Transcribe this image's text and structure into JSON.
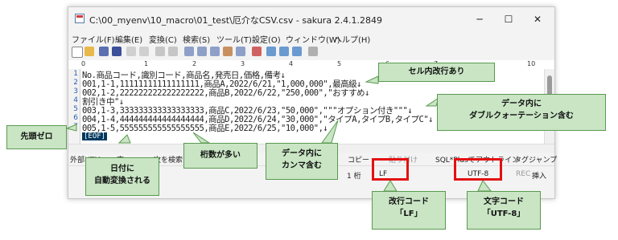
{
  "window": {
    "title": "C:\\00_myenv\\10_macro\\01_test\\厄介なCSV.csv - sakura 2.4.1.2849",
    "controls": {
      "minimize": "─",
      "maximize": "☐",
      "close": "✕"
    }
  },
  "menu": [
    "ファイル(F)",
    "編集(E)",
    "変換(C)",
    "検索(S)",
    "ツール(T)",
    "設定(O)",
    "ウィンドウ(W)",
    "ヘルプ(H)"
  ],
  "ruler": {
    "marks": [
      "0",
      "1",
      "2",
      "3",
      "4",
      "5",
      "6",
      "7",
      "10"
    ]
  },
  "editor": {
    "lines": [
      {
        "n": "1",
        "text": "No.商品コード,識別コード,商品名,発売日,価格,備考↓"
      },
      {
        "n": "2",
        "text": "001,1-1,11111111111111111,商品A,2022/6/21,\"1,000,000\",最高級↓"
      },
      {
        "n": "3",
        "text": "002,1-2,222222222222222222,商品B,2022/6/22,\"250,000\",\"おすすめ↓"
      },
      {
        "n": "4",
        "text": "割引き中\"↓"
      },
      {
        "n": "5",
        "text": "003,1-3,333333333333333333,商品C,2022/6/23,\"50,000\",\"\"\"オプション付き\"\"\"↓"
      },
      {
        "n": "6",
        "text": "004,1-4,444444444444444444,商品D,2022/6/24,\"30,000\",\"タイプA,タイプB,タイプC\"↓"
      },
      {
        "n": "7",
        "text": "005,1-5,555555555555555555,商品E,2022/6/25,\"10,000\",↓"
      }
    ],
    "eof": "[EOF]"
  },
  "findbar": {
    "external": "外部HTM",
    "search_partial": "索",
    "next_search": "次を検索",
    "copy": "コピー",
    "paste": "貼り付け",
    "sqlplus": "SQL*Plusで",
    "outline": "アウトライン",
    "tagjump": "タグジャンプ"
  },
  "status": {
    "col": "1 桁",
    "eol": "LF",
    "encoding": "UTF-8",
    "rec": "REC",
    "insert": "挿入"
  },
  "callouts": {
    "newline_in_cell": "セル内改行あり",
    "double_quote": [
      "データ内に",
      "ダブルクォーテーション含む"
    ],
    "leading_zero": "先頭ゼロ",
    "date_convert": [
      "日付に",
      "自動変換される"
    ],
    "many_digits": "桁数が多い",
    "comma_in_data": [
      "データ内に",
      "カンマ含む"
    ],
    "newline_code": [
      "改行コード",
      "「LF」"
    ],
    "char_code": [
      "文字コード",
      "「UTF-8」"
    ]
  },
  "colors": {
    "callout_fill": "#c9e5c4",
    "callout_border": "#5a9a50",
    "highlight": "#e31010",
    "linenum": "#2b5fb3",
    "eof_bg": "#003a5f"
  }
}
